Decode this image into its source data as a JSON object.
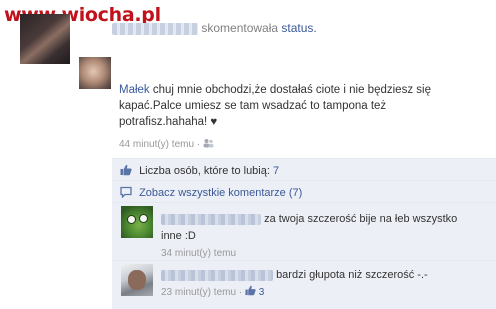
{
  "watermark": "www.wiocha.pl",
  "story": {
    "action_text": "skomentowała",
    "target_link": "status."
  },
  "comment": {
    "author": "Małek",
    "text_line1": "chuj mnie obchodzi,że dostałaś ciote i nie będziesz się",
    "text_line2": "kapać.Palce umiesz se tam wsadzać to tampona też",
    "text_line3": "potrafisz.hahaha! ♥",
    "time": "44 minut(y) temu",
    "separator": "·"
  },
  "likes": {
    "text": "Liczba osób, które to lubią:",
    "count": "7"
  },
  "view_all": {
    "text": "Zobacz wszystkie komentarze (7)"
  },
  "replies": [
    {
      "text_line1": "za twoja szczerość bije na łeb wszystko",
      "text_line2": "inne :D",
      "time": "34 minut(y) temu"
    },
    {
      "text_line1": "bardzi głupota niż szczerość -.-",
      "time": "23 minut(y) temu",
      "separator": "·",
      "like_count": "3"
    }
  ]
}
